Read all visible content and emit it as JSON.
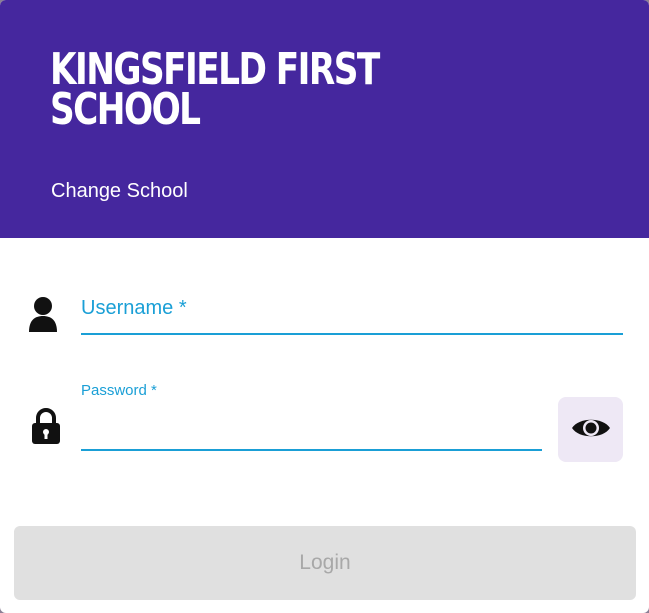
{
  "header": {
    "school_name_line1": "KINGSFIELD FIRST",
    "school_name_line2": "SCHOOL",
    "change_school_label": "Change School",
    "background_color": "#45279e"
  },
  "form": {
    "username": {
      "label": "Username *",
      "value": "",
      "icon": "user-icon"
    },
    "password": {
      "label": "Password *",
      "value": "",
      "icon": "lock-icon",
      "toggle_icon": "eye-icon"
    },
    "accent_color": "#1a9fd6",
    "login_label": "Login",
    "login_disabled": true
  }
}
